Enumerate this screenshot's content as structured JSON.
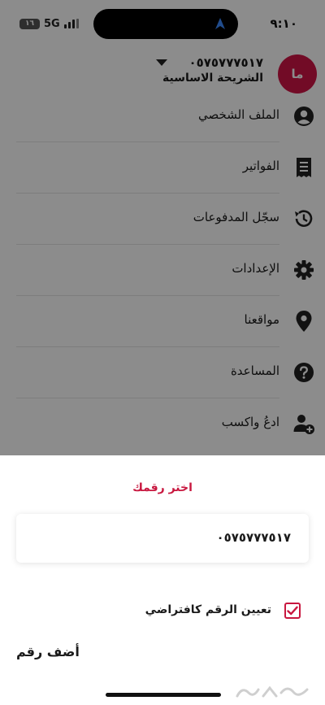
{
  "status_bar": {
    "time": "٩:١٠",
    "network": "5G",
    "battery_level": "١٦"
  },
  "account": {
    "avatar_initials": "ما",
    "number": "٠٥٧٥٧٧٧٥١٧",
    "plan": "الشريحة الاساسية"
  },
  "menu": {
    "items": [
      {
        "label": "الملف الشخصي",
        "icon": "profile-icon"
      },
      {
        "label": "الفواتير",
        "icon": "bill-icon"
      },
      {
        "label": "سجّل المدفوعات",
        "icon": "history-icon"
      },
      {
        "label": "الإعدادات",
        "icon": "gear-icon"
      },
      {
        "label": "مواقعنا",
        "icon": "location-pin-icon"
      },
      {
        "label": "المساعدة",
        "icon": "help-icon"
      },
      {
        "label": "ادعُ واكسب",
        "icon": "add-user-icon"
      }
    ]
  },
  "sheet": {
    "title": "اختر رقمك",
    "number_option": "٠٥٧٥٧٧٧٥١٧",
    "default_label": "تعيين الرقم كافتراضي",
    "default_checked": true,
    "add_number_label": "أضف رقم"
  },
  "colors": {
    "accent": "#c8173f",
    "avatar": "#d01446",
    "overlay": "rgba(0,0,0,0.45)"
  }
}
